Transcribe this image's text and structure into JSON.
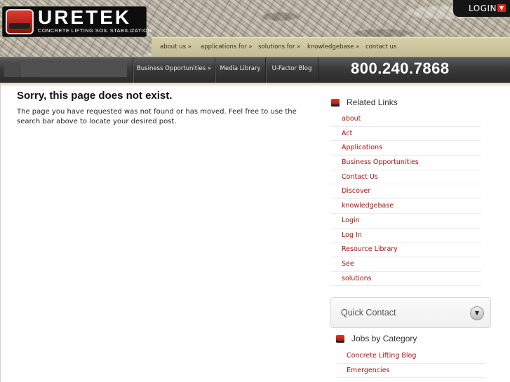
{
  "brand": {
    "name": "URETEK",
    "tagline": "CONCRETE LIFTING   SOIL STABILIZATION"
  },
  "login": {
    "label": "LOGIN",
    "arrow": "▼"
  },
  "topnav": [
    "about us »",
    "applications for »",
    "solutions for »",
    "knowledgebase »",
    "contact us"
  ],
  "search": {
    "value": "",
    "placeholder": ""
  },
  "mainnav": [
    "Business Opportunities »",
    "Media Library",
    "U-Factor Blog"
  ],
  "phone": "800.240.7868",
  "main": {
    "title": "Sorry, this page does not exist.",
    "text": "The page you have requested was not found or has moved. Feel free to use the search bar above to locate your desired post."
  },
  "related": {
    "title": "Related Links",
    "links": [
      "about",
      "Act",
      "Applications",
      "Business Opportunities",
      "Contact Us",
      "Discover",
      "knowledgebase",
      "Login",
      "Log In",
      "Resource Library",
      "See",
      "solutions"
    ]
  },
  "quick_contact": {
    "label": "Quick Contact",
    "toggle": "▼"
  },
  "jobs": {
    "title": "Jobs by Category",
    "links": [
      "Concrete Lifting Blog",
      "Emergencies"
    ]
  },
  "colors": {
    "accent": "#d9231b",
    "link": "#b01010",
    "nav_bg": "#2b2b2b"
  }
}
